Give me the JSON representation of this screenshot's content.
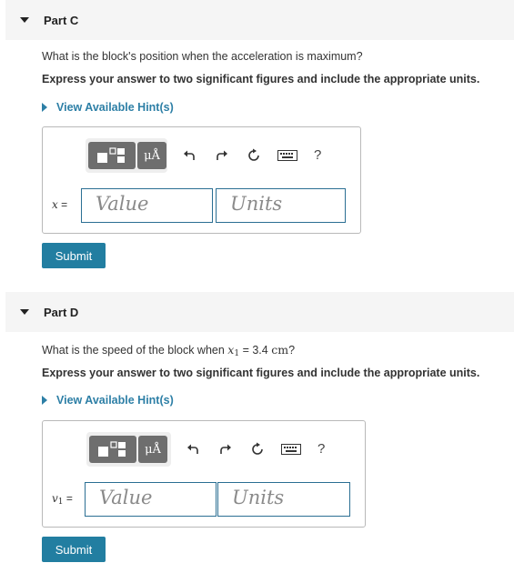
{
  "partC": {
    "title": "Part C",
    "question": "What is the block's position when the acceleration is maximum?",
    "instructions": "Express your answer to two significant figures and include the appropriate units.",
    "hint_label": "View Available Hint(s)",
    "variable": "x",
    "equals": "=",
    "value_placeholder": "Value",
    "units_placeholder": "Units",
    "submit_label": "Submit"
  },
  "partD": {
    "title": "Part D",
    "question_prefix": "What is the speed of the block when",
    "question_var": "x",
    "question_sub": "1",
    "question_equals": " = 3.4",
    "question_unit": "cm",
    "question_suffix": "?",
    "instructions": "Express your answer to two significant figures and include the appropriate units.",
    "hint_label": "View Available Hint(s)",
    "variable": "v",
    "variable_sub": "1",
    "equals": "=",
    "value_placeholder": "Value",
    "units_placeholder": "Units",
    "submit_label": "Submit"
  },
  "toolbar": {
    "mu_label": "μÅ",
    "help_label": "?",
    "icons": [
      "templates-icon",
      "units-icon",
      "undo-icon",
      "redo-icon",
      "reset-icon",
      "keyboard-icon",
      "help-icon"
    ]
  },
  "colors": {
    "accent": "#227ea1",
    "link": "#2d7fa6",
    "header_bg": "#f5f5f5",
    "field_border": "#2b6f93"
  }
}
